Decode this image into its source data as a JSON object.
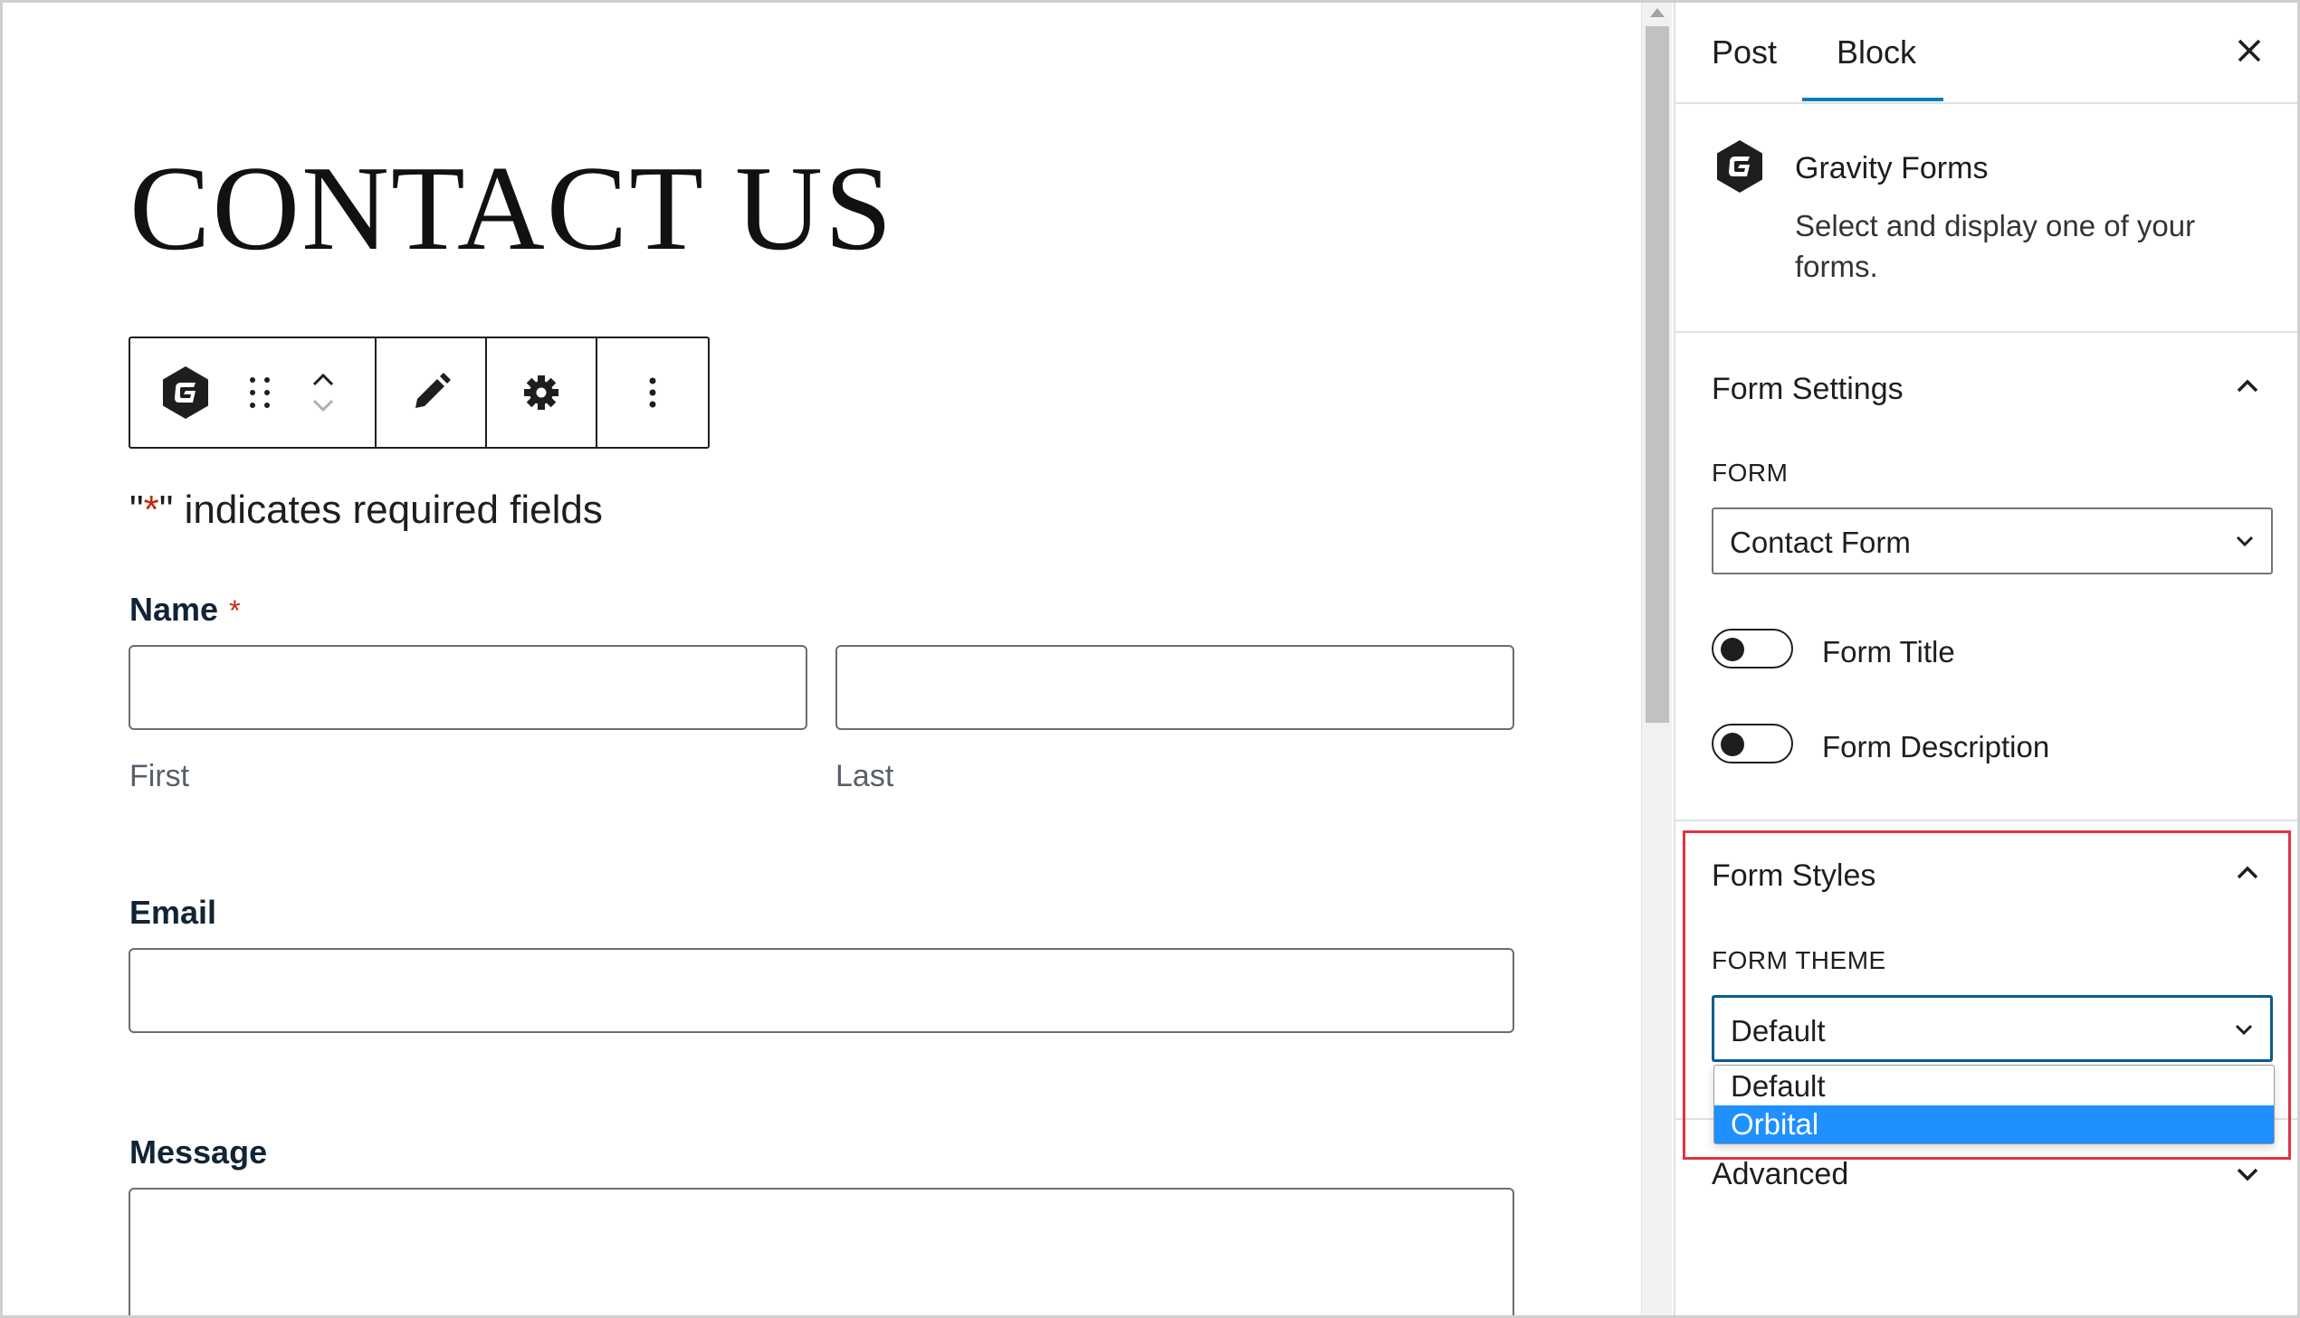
{
  "editor": {
    "page_title": "CONTACT US",
    "required_note": {
      "prefix": "\"",
      "star": "*",
      "suffix": "\" indicates required fields"
    },
    "fields": {
      "name": {
        "label": "Name",
        "required_mark": "*",
        "first_sublabel": "First",
        "last_sublabel": "Last"
      },
      "email": {
        "label": "Email"
      },
      "message": {
        "label": "Message"
      }
    },
    "toolbar": {
      "block_icon": "gravity-forms-icon",
      "drag_icon": "drag-handle-icon",
      "move_up_icon": "chevron-up-icon",
      "move_down_icon": "chevron-down-icon",
      "edit_icon": "pencil-icon",
      "settings_icon": "gear-icon",
      "options_icon": "more-vertical-icon"
    }
  },
  "sidebar": {
    "tabs": [
      {
        "label": "Post",
        "active": false
      },
      {
        "label": "Block",
        "active": true
      }
    ],
    "close_icon": "close-icon",
    "block_card": {
      "icon": "gravity-forms-icon",
      "title": "Gravity Forms",
      "description": "Select and display one of your forms."
    },
    "form_settings": {
      "title": "Form Settings",
      "expanded": true,
      "form_label": "FORM",
      "form_value": "Contact Form",
      "toggles": [
        {
          "label": "Form Title",
          "checked": false
        },
        {
          "label": "Form Description",
          "checked": false
        }
      ]
    },
    "form_styles": {
      "title": "Form Styles",
      "expanded": true,
      "theme_label": "FORM THEME",
      "theme_value": "Default",
      "theme_options": [
        {
          "label": "Default",
          "highlighted": false
        },
        {
          "label": "Orbital",
          "highlighted": true
        }
      ]
    },
    "advanced": {
      "title": "Advanced",
      "expanded": false
    }
  },
  "colors": {
    "accent": "#007cba",
    "required": "#c02b0a",
    "highlight_border": "#e2333f",
    "option_highlight": "#1e90ff",
    "field_label": "#112337"
  }
}
